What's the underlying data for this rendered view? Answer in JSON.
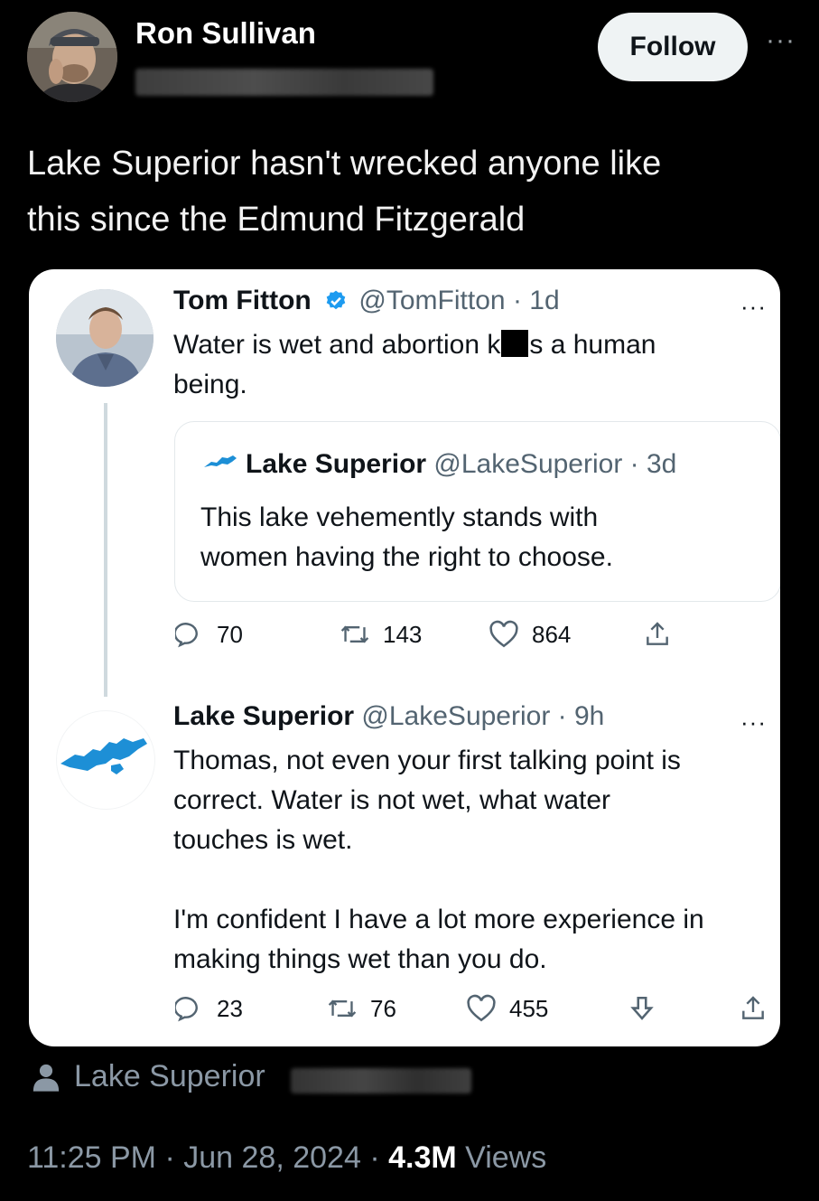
{
  "header": {
    "author_name": "Ron Sullivan",
    "follow_label": "Follow",
    "more_label": "···"
  },
  "tweet": {
    "text_line1": "Lake Superior hasn't wrecked anyone like",
    "text_line2": "this since the Edmund Fitzgerald"
  },
  "screenshot": {
    "tweet1": {
      "name": "Tom Fitton",
      "handle": "@TomFitton",
      "age": "· 1d",
      "more_label": "···",
      "text_a": "Water is wet and abortion k",
      "text_b": "s a human",
      "text_c": "being.",
      "quoted": {
        "name": "Lake Superior",
        "handle": "@LakeSuperior",
        "age": "· 3d",
        "line1": "This lake vehemently stands with",
        "line2": "women having the right to choose."
      },
      "stats": {
        "replies": "70",
        "retweets": "143",
        "likes": "864"
      }
    },
    "tweet2": {
      "name": "Lake Superior",
      "handle": "@LakeSuperior",
      "age": "· 9h",
      "more_label": "···",
      "line1": "Thomas, not even your first talking point is",
      "line2": "correct. Water is not wet, what water",
      "line3": "touches is wet.",
      "line4": "I'm confident I have a lot more experience in",
      "line5": "making things wet than you do.",
      "stats": {
        "replies": "23",
        "retweets": "76",
        "likes": "455"
      }
    }
  },
  "footer": {
    "community_label": "Lake Superior",
    "time": "11:25 PM",
    "date": "Jun 28, 2024",
    "views_count": "4.3M",
    "views_label": "Views",
    "sep": "·"
  },
  "colors": {
    "background": "#000000",
    "card": "#ffffff",
    "verified": "#1d9bf0",
    "lake_icon": "#1d8fd6",
    "muted": "#536471"
  }
}
